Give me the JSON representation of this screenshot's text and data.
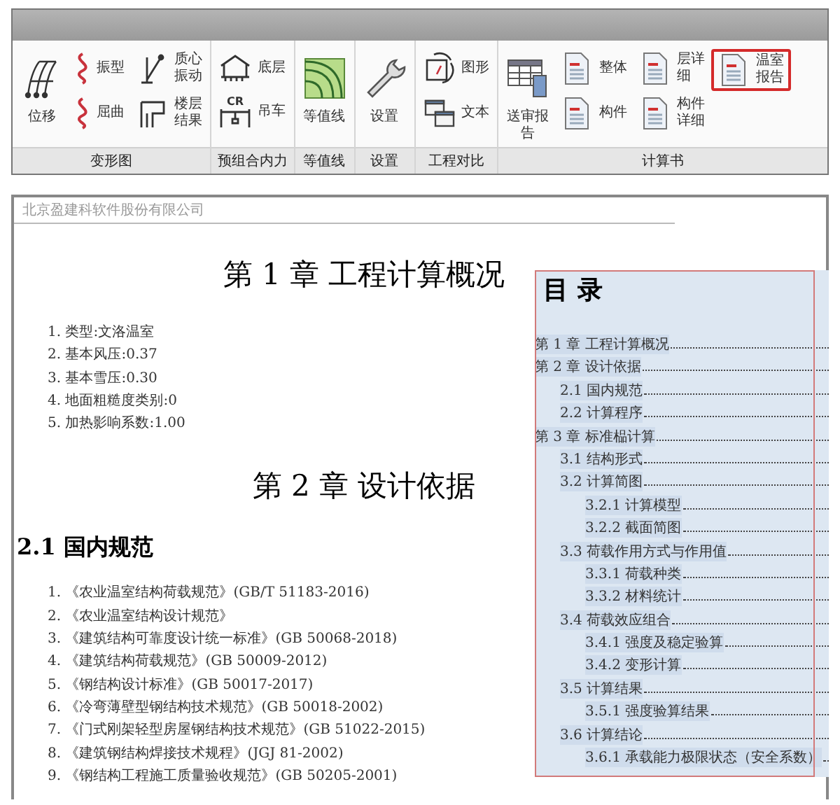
{
  "ribbon": {
    "groups": [
      {
        "label": "变形图",
        "columns": [
          {
            "kind": "large",
            "items": [
              {
                "label": "位移",
                "kind": "frame",
                "highlighted": false
              }
            ]
          },
          {
            "kind": "stack",
            "items": [
              {
                "label": "振型",
                "kind": "wave",
                "highlighted": false
              },
              {
                "label": "屈曲",
                "kind": "wave",
                "highlighted": false
              }
            ]
          },
          {
            "kind": "stack",
            "items": [
              {
                "label": "质心振动",
                "kind": "pole",
                "highlighted": false
              },
              {
                "label": "楼层结果",
                "kind": "floor",
                "highlighted": false
              }
            ]
          }
        ]
      },
      {
        "label": "预组合内力",
        "columns": [
          {
            "kind": "stack",
            "items": [
              {
                "label": "底层",
                "kind": "house",
                "highlighted": false
              },
              {
                "label": "吊车",
                "kind": "crane",
                "icon_text": "CR",
                "highlighted": false
              }
            ]
          }
        ]
      },
      {
        "label": "等值线",
        "columns": [
          {
            "kind": "large",
            "items": [
              {
                "label": "等值线",
                "kind": "contour",
                "highlighted": false
              }
            ]
          }
        ]
      },
      {
        "label": "设置",
        "columns": [
          {
            "kind": "large",
            "items": [
              {
                "label": "设置",
                "kind": "wrench",
                "highlighted": false
              }
            ]
          }
        ]
      },
      {
        "label": "工程对比",
        "columns": [
          {
            "kind": "stack",
            "items": [
              {
                "label": "图形",
                "kind": "compare",
                "highlighted": false
              },
              {
                "label": "文本",
                "kind": "windows",
                "highlighted": false
              }
            ]
          }
        ]
      },
      {
        "label": "计算书",
        "columns": [
          {
            "kind": "large",
            "items": [
              {
                "label": "送审报告",
                "kind": "table",
                "highlighted": false
              }
            ]
          },
          {
            "kind": "stack",
            "items": [
              {
                "label": "整体",
                "kind": "doc",
                "highlighted": false
              },
              {
                "label": "构件",
                "kind": "doc",
                "highlighted": false
              }
            ]
          },
          {
            "kind": "stack",
            "items": [
              {
                "label": "层详细",
                "kind": "doc",
                "highlighted": false
              },
              {
                "label": "构件详细",
                "kind": "doc",
                "highlighted": false
              }
            ]
          },
          {
            "kind": "stack",
            "items": [
              {
                "label": "温室报告",
                "kind": "doc",
                "highlighted": true
              }
            ]
          }
        ]
      }
    ]
  },
  "document": {
    "header": "北京盈建科软件股份有限公司",
    "blocks": [
      {
        "kind": "chapter",
        "text": "第 1 章 工程计算概况"
      },
      {
        "kind": "list",
        "items": [
          "1. 类型:文洛温室",
          "2. 基本风压:0.37",
          "3. 基本雪压:0.30",
          "4. 地面粗糙度类别:0",
          "5. 加热影响系数:1.00"
        ]
      },
      {
        "kind": "chapter",
        "text": "第 2 章 设计依据"
      },
      {
        "kind": "section",
        "text": "2.1 国内规范"
      },
      {
        "kind": "list",
        "items": [
          "1. 《农业温室结构荷载规范》(GB/T 51183-2016)",
          "2. 《农业温室结构设计规范》",
          "3. 《建筑结构可靠度设计统一标准》(GB 50068-2018)",
          "4. 《建筑结构荷载规范》(GB 50009-2012)",
          "5. 《钢结构设计标准》(GB 50017-2017)",
          "6. 《冷弯薄壁型钢结构技术规范》(GB 50018-2002)",
          "7. 《门式刚架轻型房屋钢结构技术规范》(GB 51022-2015)",
          "8. 《建筑钢结构焊接技术规程》(JGJ 81-2002)",
          "9. 《钢结构工程施工质量验收规范》(GB 50205-2001)"
        ]
      }
    ],
    "toc": {
      "title": "目 录",
      "entries": [
        {
          "text": "第 1 章 工程计算概况"
        },
        {
          "text": "第 2 章 设计依据",
          "children": [
            {
              "text": "2.1 国内规范"
            },
            {
              "text": "2.2 计算程序"
            }
          ]
        },
        {
          "text": "第 3 章 标准榀计算",
          "children": [
            {
              "text": "3.1 结构形式"
            },
            {
              "text": "3.2 计算简图",
              "children": [
                {
                  "text": "3.2.1 计算模型"
                },
                {
                  "text": "3.2.2 截面简图"
                }
              ]
            },
            {
              "text": "3.3 荷载作用方式与作用值",
              "children": [
                {
                  "text": "3.3.1 荷载种类"
                },
                {
                  "text": "3.3.2 材料统计"
                }
              ]
            },
            {
              "text": "3.4 荷载效应组合",
              "children": [
                {
                  "text": "3.4.1 强度及稳定验算"
                },
                {
                  "text": "3.4.2 变形计算"
                }
              ]
            },
            {
              "text": "3.5 计算结果",
              "children": [
                {
                  "text": "3.5.1 强度验算结果"
                }
              ]
            },
            {
              "text": "3.6 计算结论",
              "children": [
                {
                  "text": "3.6.1 承载能力极限状态（安全系数）"
                }
              ]
            }
          ]
        }
      ]
    }
  }
}
